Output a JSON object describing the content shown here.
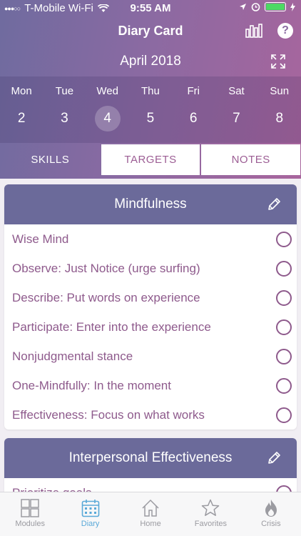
{
  "status": {
    "carrier": "T-Mobile Wi-Fi",
    "time": "9:55 AM"
  },
  "nav": {
    "title": "Diary Card",
    "help_label": "?"
  },
  "calendar": {
    "month": "April 2018",
    "days": [
      "Mon",
      "Tue",
      "Wed",
      "Thu",
      "Fri",
      "Sat",
      "Sun"
    ],
    "dates": [
      "2",
      "3",
      "4",
      "5",
      "6",
      "7",
      "8"
    ],
    "selected_date": "4"
  },
  "tabs": [
    "SKILLS",
    "TARGETS",
    "NOTES"
  ],
  "sections": [
    {
      "title": "Mindfulness",
      "skills": [
        "Wise Mind",
        "Observe: Just Notice (urge surfing)",
        "Describe: Put words on experience",
        "Participate:  Enter into the experience",
        "Nonjudgmental stance",
        "One-Mindfully: In the moment",
        "Effectiveness:  Focus on what works"
      ]
    },
    {
      "title": "Interpersonal Effectiveness",
      "skills": [
        "Prioritize goals"
      ]
    }
  ],
  "bottom_nav": [
    "Modules",
    "Diary",
    "Home",
    "Favorites",
    "Crisis"
  ],
  "colors": {
    "accent": "#8e5a8c",
    "section_header": "#6b6a9a",
    "active_tab": "#5aa9d8"
  }
}
